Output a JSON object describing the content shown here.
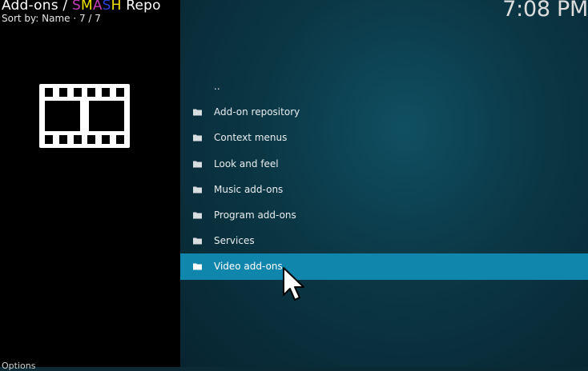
{
  "header": {
    "title_prefix": "Add-ons / ",
    "repo_letters": [
      "S",
      "M",
      "A",
      "S",
      "H"
    ],
    "repo_suffix": " Repo",
    "sort_text": "Sort by: Name  ·  7 / 7",
    "clock": "7:08 PM"
  },
  "sidebar": {
    "icon": "film-strip-icon",
    "options_label": "Options"
  },
  "list": {
    "items": [
      {
        "label": "..",
        "icon": ""
      },
      {
        "label": "Add-on repository",
        "icon": "folder-icon"
      },
      {
        "label": "Context menus",
        "icon": "folder-icon"
      },
      {
        "label": "Look and feel",
        "icon": "folder-icon"
      },
      {
        "label": "Music add-ons",
        "icon": "folder-icon"
      },
      {
        "label": "Program add-ons",
        "icon": "folder-icon"
      },
      {
        "label": "Services",
        "icon": "folder-icon"
      },
      {
        "label": "Video add-ons",
        "icon": "folder-icon"
      }
    ],
    "selected_label": "Video add-ons"
  },
  "colors": {
    "selection": "#1186ad",
    "sidebar": "#000000",
    "background": "#0b3745"
  }
}
